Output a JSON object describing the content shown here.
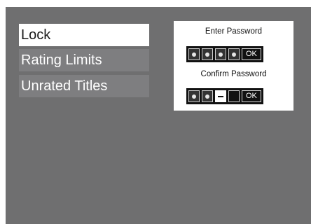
{
  "menu": {
    "items": [
      {
        "label": "Lock",
        "selected": true
      },
      {
        "label": "Rating Limits",
        "selected": false
      },
      {
        "label": "Unrated Titles",
        "selected": false
      }
    ]
  },
  "lock_panel": {
    "enter_label": "Enter Password",
    "confirm_label": "Confirm Password",
    "enter_password": {
      "digits_entered": 4,
      "ok_label": "OK"
    },
    "confirm_password": {
      "digits_entered": 2,
      "ok_label": "OK"
    }
  },
  "colors": {
    "background": "#6f6f70",
    "menu_item": "#7e7e80",
    "menu_item_selected": "#ffffff"
  }
}
